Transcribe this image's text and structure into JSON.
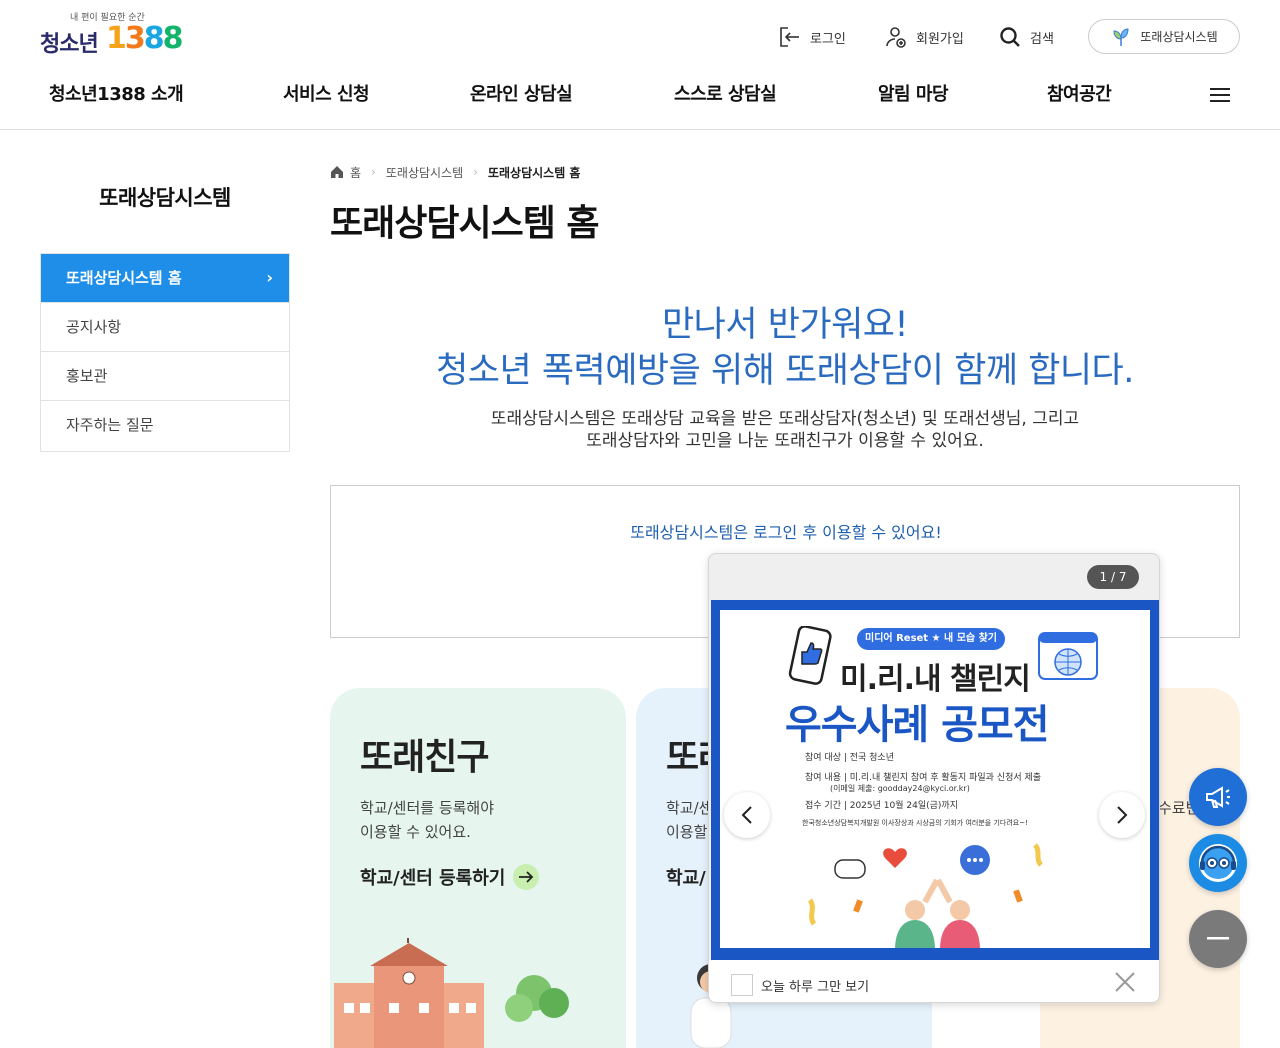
{
  "header": {
    "logo_tag": "내 편이 필요한 순간",
    "logo_name": "청소년",
    "logo_number": [
      "1",
      "3",
      "8",
      "8"
    ],
    "login": "로그인",
    "signup": "회원가입",
    "search": "검색",
    "ddorae_system": "또래상담시스템"
  },
  "gnb": [
    "청소년1388 소개",
    "서비스 신청",
    "온라인 상담실",
    "스스로 상담실",
    "알림 마당",
    "참여공간"
  ],
  "sidebar": {
    "title": "또래상담시스템",
    "items": [
      {
        "label": "또래상담시스템 홈",
        "active": true
      },
      {
        "label": "공지사항"
      },
      {
        "label": "홍보관"
      },
      {
        "label": "자주하는 질문"
      }
    ]
  },
  "breadcrumb": [
    "홈",
    "또래상담시스템",
    "또래상담시스템 홈"
  ],
  "page_title": "또래상담시스템 홈",
  "hero": {
    "line1": "만나서 반가워요!",
    "line2": "청소년 폭력예방을 위해 또래상담이 함께 합니다.",
    "desc1": "또래상담시스템은 또래상담 교육을 받은 또래상담자(청소년) 및 또래선생님, 그리고",
    "desc2": "또래상담자와 고민을 나눈 또래친구가 이용할 수 있어요."
  },
  "login_notice": "또래상담시스템은 로그인 후 이용할 수 있어요!",
  "cards": [
    {
      "title": "또래친구",
      "desc1": "학교/센터를 등록해야",
      "desc2": "이용할 수 있어요.",
      "link": "학교/센터 등록하기"
    },
    {
      "title": "또래",
      "desc1": "학교/센",
      "desc2": "이용할",
      "link": "학교/"
    },
    {
      "desc1": "수료번"
    }
  ],
  "popup": {
    "counter": "1 / 7",
    "poster_badge": "미디어 Reset ★ 내 모습 찾기",
    "poster_title1": "미.리.내 챌린지",
    "poster_title2": "우수사례 공모전",
    "info": [
      "참여 대상 | 전국 청소년",
      "참여 내용 | 미.리.내 챌린지 참여 후 활동지 파일과 신청서 제출",
      "(이메일 제출: goodday24@kyci.or.kr)",
      "접수 기간 | 2025년 10월 24일(금)까지",
      "한국청소년상담복지개발원 이사장상과 시상금의 기회가 여러분을 기다려요~!"
    ],
    "today_hide": "오늘 하루 그만 보기"
  },
  "colors": {
    "primary": "#1f8ee8",
    "hero_text": "#2a6bc0",
    "poster_blue": "#1a56c4"
  }
}
